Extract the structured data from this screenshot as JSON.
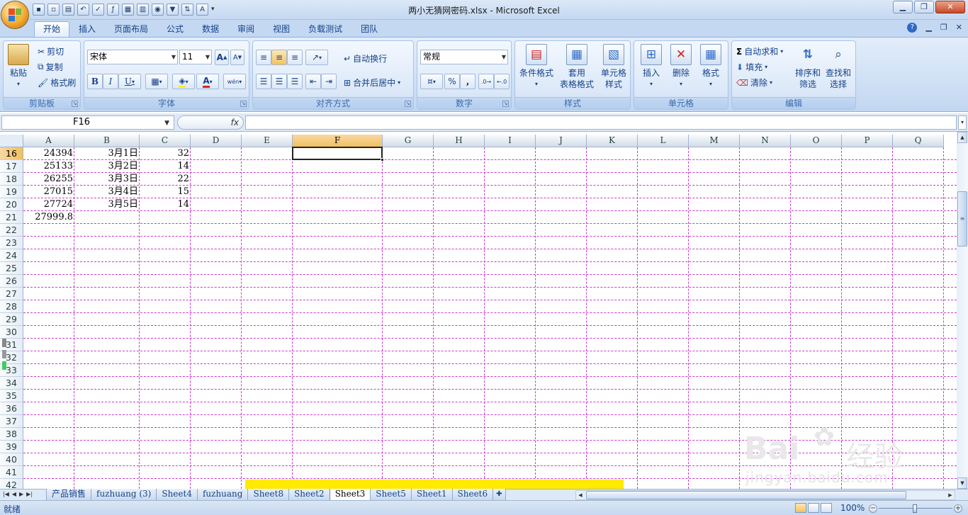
{
  "window": {
    "title": "两小无猜网密码.xlsx - Microsoft Excel"
  },
  "quick_access": [
    "save-icon",
    "open-icon",
    "print-preview-icon",
    "undo-icon",
    "spelling-icon",
    "function-icon",
    "table-icon",
    "form-icon",
    "camera-icon",
    "filter-icon",
    "sort-icon",
    "text-icon"
  ],
  "ribbon_tabs": [
    "开始",
    "插入",
    "页面布局",
    "公式",
    "数据",
    "审阅",
    "视图",
    "负载测试",
    "团队"
  ],
  "ribbon": {
    "clipboard": {
      "group": "剪贴板",
      "paste": "粘贴",
      "cut": "剪切",
      "copy": "复制",
      "format_painter": "格式刷"
    },
    "font": {
      "group": "字体",
      "font_name": "宋体",
      "font_size": "11",
      "bold": "B",
      "italic": "I",
      "underline": "U",
      "grow": "A",
      "shrink": "A",
      "font_color": "A",
      "pinyin": "wén"
    },
    "alignment": {
      "group": "对齐方式",
      "wrap": "自动换行",
      "merge": "合并后居中"
    },
    "number": {
      "group": "数字",
      "format": "常规",
      "percent": "%",
      "comma": ","
    },
    "styles": {
      "group": "样式",
      "conditional": "条件格式",
      "table_line1": "套用",
      "table_line2": "表格格式",
      "cell_style_line1": "单元格",
      "cell_style_line2": "样式"
    },
    "cells": {
      "group": "单元格",
      "insert": "插入",
      "delete": "删除",
      "format": "格式"
    },
    "editing": {
      "group": "编辑",
      "autosum": "自动求和",
      "fill": "填充",
      "clear": "清除",
      "sort_line1": "排序和",
      "sort_line2": "筛选",
      "find_line1": "查找和",
      "find_line2": "选择"
    }
  },
  "formula_bar": {
    "name_box": "F16",
    "fx": "fx",
    "formula": ""
  },
  "columns": [
    "A",
    "B",
    "C",
    "D",
    "E",
    "F",
    "G",
    "H",
    "I",
    "J",
    "K",
    "L",
    "M",
    "N",
    "O",
    "P",
    "Q"
  ],
  "rows": [
    "16",
    "17",
    "18",
    "19",
    "20",
    "21",
    "22",
    "23",
    "24",
    "25",
    "26",
    "27",
    "28",
    "29",
    "30",
    "31",
    "32",
    "33",
    "34",
    "35",
    "36",
    "37",
    "38",
    "39",
    "40",
    "41",
    "42"
  ],
  "cells": [
    {
      "row": 0,
      "col": 0,
      "value": "24394"
    },
    {
      "row": 0,
      "col": 1,
      "value": "3月1日"
    },
    {
      "row": 0,
      "col": 2,
      "value": "32"
    },
    {
      "row": 1,
      "col": 0,
      "value": "25133"
    },
    {
      "row": 1,
      "col": 1,
      "value": "3月2日"
    },
    {
      "row": 1,
      "col": 2,
      "value": "14"
    },
    {
      "row": 2,
      "col": 0,
      "value": "26255"
    },
    {
      "row": 2,
      "col": 1,
      "value": "3月3日"
    },
    {
      "row": 2,
      "col": 2,
      "value": "22"
    },
    {
      "row": 3,
      "col": 0,
      "value": "27015"
    },
    {
      "row": 3,
      "col": 1,
      "value": "3月4日"
    },
    {
      "row": 3,
      "col": 2,
      "value": "15"
    },
    {
      "row": 4,
      "col": 0,
      "value": "27724"
    },
    {
      "row": 4,
      "col": 1,
      "value": "3月5日"
    },
    {
      "row": 4,
      "col": 2,
      "value": "14"
    },
    {
      "row": 5,
      "col": 0,
      "value": "27999.8"
    }
  ],
  "active_cell": {
    "row": 0,
    "col": 5
  },
  "sheet_tabs": [
    "产品销售",
    "fuzhuang (3)",
    "Sheet4",
    "fuzhuang",
    "Sheet8",
    "Sheet2",
    "Sheet3",
    "Sheet5",
    "Sheet1",
    "Sheet6"
  ],
  "active_sheet": "Sheet3",
  "status": {
    "text": "就绪",
    "zoom": "100%"
  },
  "watermark": {
    "brand_left": "Bai",
    "brand_right": "经验",
    "url": "jingyan.baidu.com"
  },
  "colors": {
    "gridline": "#c83ccd",
    "selection_header": "#f1c05e",
    "yellow_highlight": "#ffea00"
  }
}
